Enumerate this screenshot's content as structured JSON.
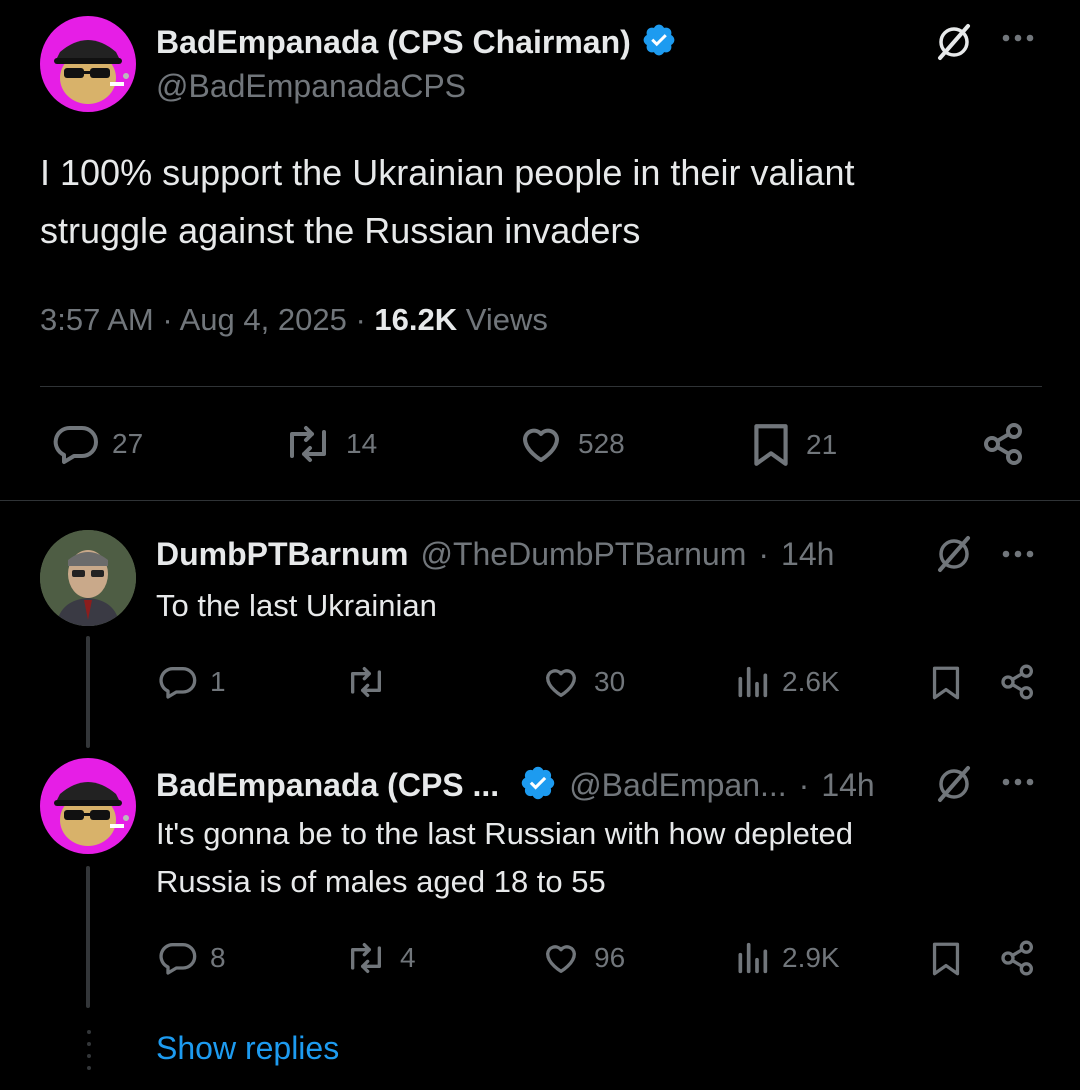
{
  "main_tweet": {
    "display_name": "BadEmpanada (CPS Chairman)",
    "handle": "@BadEmpanadaCPS",
    "text_line1": "I 100% support the Ukrainian people in their valiant",
    "text_line2": "struggle against the Russian invaders",
    "time": "3:57 AM",
    "date": "Aug 4, 2025",
    "views_count": "16.2K",
    "views_label": "Views",
    "replies": "27",
    "reposts": "14",
    "likes": "528",
    "bookmarks": "21"
  },
  "reply1": {
    "display_name": "DumbPTBarnum",
    "handle": "@TheDumbPTBarnum",
    "age": "14h",
    "text": "To the last Ukrainian",
    "replies": "1",
    "likes": "30",
    "views": "2.6K"
  },
  "reply2": {
    "display_name": "BadEmpanada (CPS ...",
    "handle": "@BadEmpan...",
    "age": "14h",
    "text_line1": "It's gonna be to the last Russian with how depleted",
    "text_line2": "Russia is of males aged 18 to 55",
    "replies": "8",
    "reposts": "4",
    "likes": "96",
    "views": "2.9K"
  },
  "show_replies": "Show replies",
  "colors": {
    "background": "#000000",
    "text": "#e7e9ea",
    "muted": "#71767b",
    "accent": "#1d9bf0",
    "verified": "#1d9bf0",
    "avatar_bg": "#e61ee6"
  },
  "icons": [
    "grok-icon",
    "more-icon",
    "verified-badge-icon",
    "reply-icon",
    "repost-icon",
    "like-icon",
    "bookmark-icon",
    "share-icon",
    "views-icon"
  ]
}
